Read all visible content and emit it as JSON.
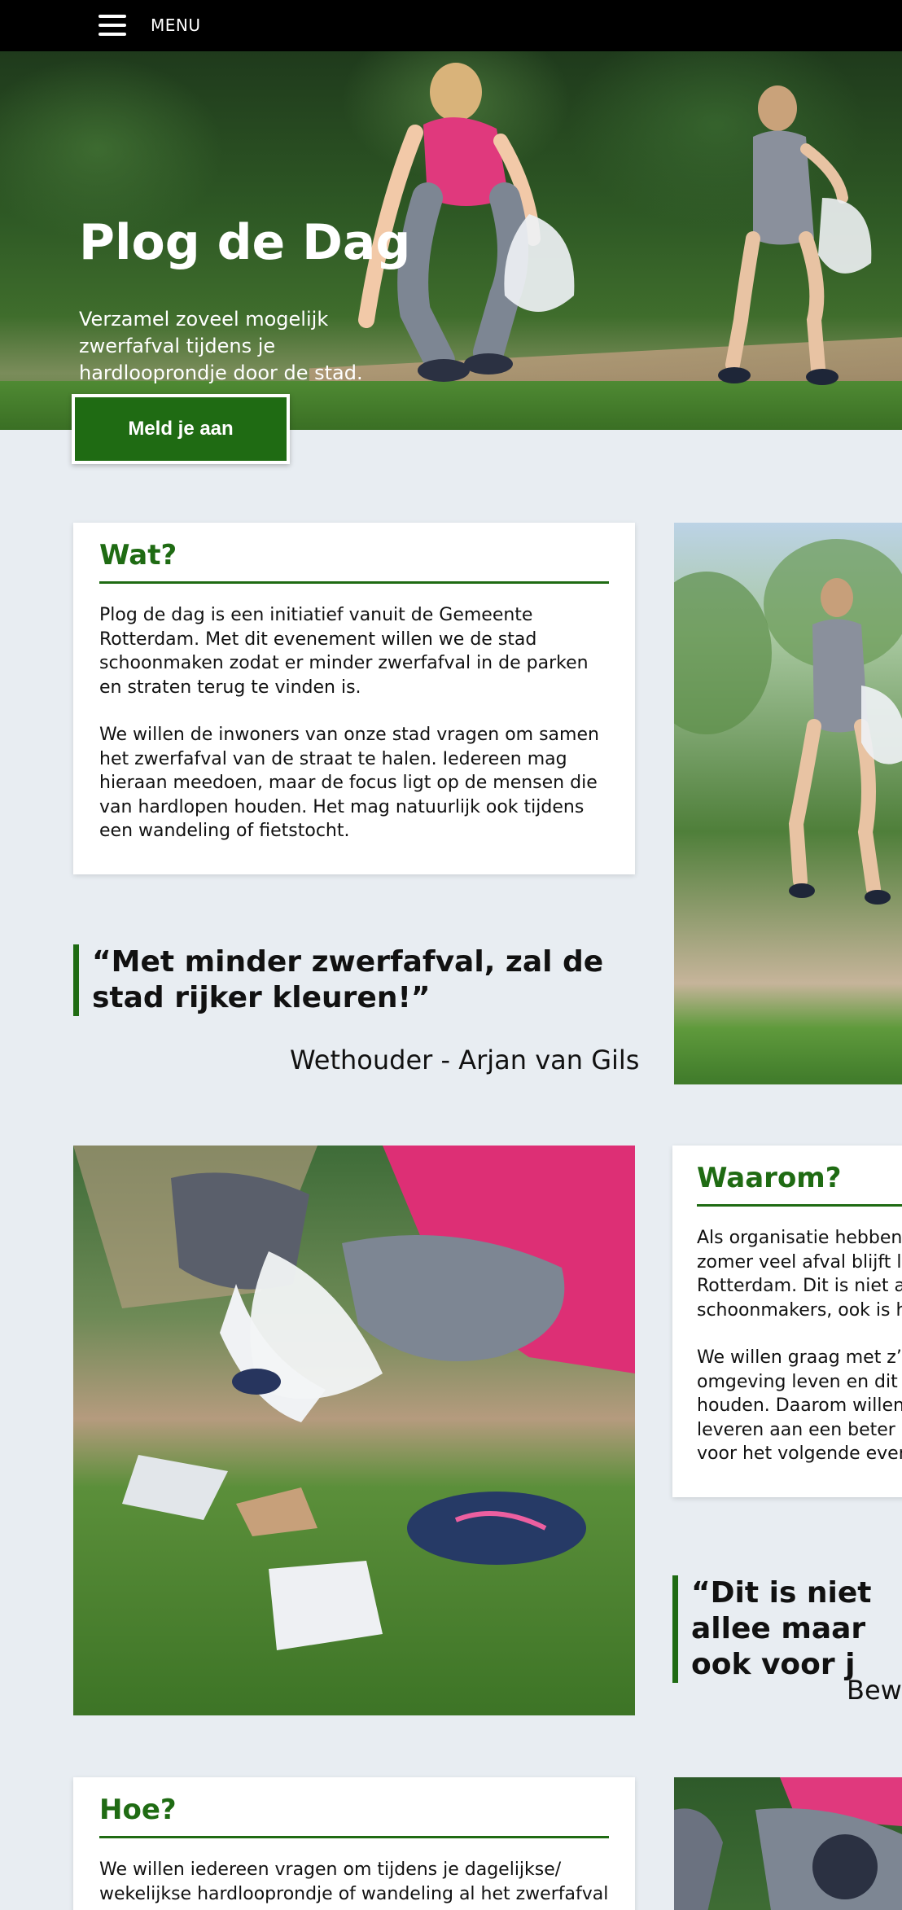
{
  "nav": {
    "menu_label": "MENU"
  },
  "hero": {
    "title": "Plog de Dag",
    "subtitle": "Verzamel zoveel mogelijk zwerfafval tijdens je hardlooprondje door de stad.",
    "cta_label": "Meld je aan"
  },
  "wat": {
    "title": "Wat?",
    "paragraphs": [
      "Plog de dag is een initiatief vanuit de Gemeente Rotterdam. Met dit evenement willen we de stad schoonmaken zodat er minder zwerfafval in de parken en straten terug te vinden is.",
      "We willen de inwoners van onze stad vragen om samen het zwerfafval van de straat te halen. Iedereen mag hieraan meedoen, maar de focus ligt op de mensen die van hardlopen houden. Het mag natuurlijk ook tijdens een wandeling of fietstocht."
    ]
  },
  "quote1": {
    "text": "“Met minder zwerfafval, zal de stad rijker kleuren!”",
    "attribution": "Wethouder - Arjan van Gils"
  },
  "waarom": {
    "title": "Waarom?",
    "paragraphs": [
      "Als organisatie hebben zomer veel afval blijft li Rotterdam. Dit is niet al schoonmakers, ook is he",
      "We willen graag met z’n omgeving leven en dit k houden. Daarom willen leveren aan een beter n voor het volgende even"
    ]
  },
  "quote2": {
    "text": "“Dit is niet allee maar ook voor j",
    "attribution": "Bewo"
  },
  "hoe": {
    "title": "Hoe?",
    "paragraph": "We willen iedereen vragen om tijdens je dagelijkse/ wekelijkse hardlooprondje of wandeling al het zwerfafval"
  },
  "colors": {
    "brand_green": "#1f6b13",
    "background": "#e8edf2",
    "topbar": "#000000"
  }
}
